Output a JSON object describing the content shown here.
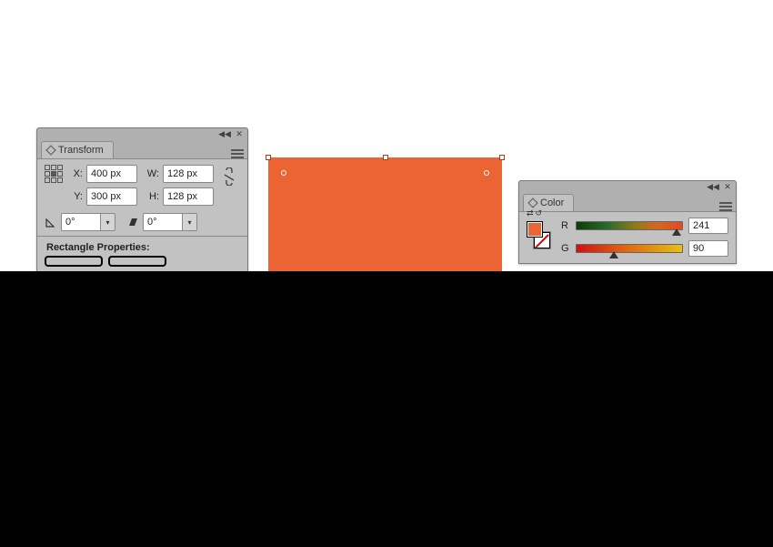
{
  "transform": {
    "title": "Transform",
    "x_label": "X:",
    "y_label": "Y:",
    "w_label": "W:",
    "h_label": "H:",
    "x": "400 px",
    "y": "300 px",
    "w": "128 px",
    "h": "128 px",
    "rotate": "0°",
    "shear": "0°",
    "section": "Rectangle Properties:"
  },
  "color": {
    "title": "Color",
    "channels": [
      {
        "label": "R",
        "value": "241",
        "pct": 94.5,
        "cls": "r"
      },
      {
        "label": "G",
        "value": "90",
        "pct": 35.3,
        "cls": "g"
      }
    ],
    "fill": "#eb6433"
  },
  "shape": {
    "fill": "#eb6433"
  }
}
